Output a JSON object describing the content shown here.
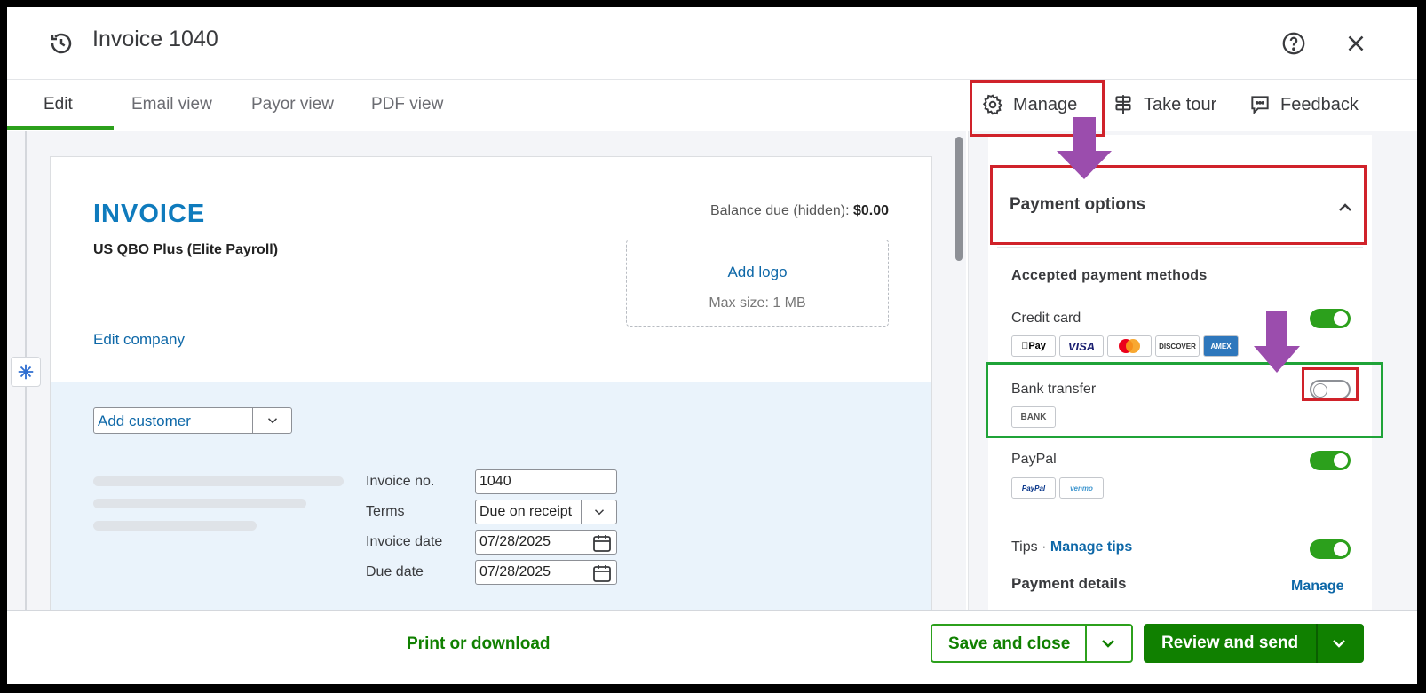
{
  "header": {
    "title": "Invoice 1040"
  },
  "tabs": [
    {
      "label": "Edit"
    },
    {
      "label": "Email view"
    },
    {
      "label": "Payor view"
    },
    {
      "label": "PDF view"
    }
  ],
  "toolbar": {
    "manage": "Manage",
    "take_tour": "Take tour",
    "feedback": "Feedback"
  },
  "invoice": {
    "title": "INVOICE",
    "company": "US QBO Plus (Elite Payroll)",
    "edit_company": "Edit company",
    "balance_label": "Balance due (hidden): ",
    "balance_value": "$0.00",
    "add_logo": "Add logo",
    "max_size": "Max size: 1 MB",
    "add_customer": "Add customer",
    "fields": {
      "invoice_no_label": "Invoice no.",
      "invoice_no_value": "1040",
      "terms_label": "Terms",
      "terms_value": "Due on receipt",
      "invoice_date_label": "Invoice date",
      "invoice_date_value": "07/28/2025",
      "due_date_label": "Due date",
      "due_date_value": "07/28/2025"
    }
  },
  "payment_panel": {
    "heading": "Payment options",
    "accepted_heading": "Accepted payment methods",
    "methods": [
      {
        "label": "Credit card",
        "enabled": true,
        "badges": [
          "Pay",
          "VISA",
          "",
          "DISCOVER",
          "AMEX"
        ]
      },
      {
        "label": "Bank transfer",
        "enabled": false,
        "badges": [
          "BANK"
        ]
      },
      {
        "label": "PayPal",
        "enabled": true,
        "badges": [
          "PayPal",
          "venmo"
        ]
      }
    ],
    "tips_label": "Tips · ",
    "tips_link": "Manage tips",
    "tips_enabled": true,
    "payment_details": "Payment details",
    "payment_details_manage": "Manage"
  },
  "footer": {
    "print": "Print or download",
    "save_close": "Save and close",
    "review_send": "Review and send"
  },
  "colors": {
    "brand_green": "#108000",
    "toggle_green": "#2ca01c",
    "link_blue": "#0e68a8",
    "invoice_blue": "#0f7bbd",
    "annotation_red": "#d0222a",
    "annotation_green": "#1fa338",
    "annotation_arrow": "#9b4dad"
  }
}
